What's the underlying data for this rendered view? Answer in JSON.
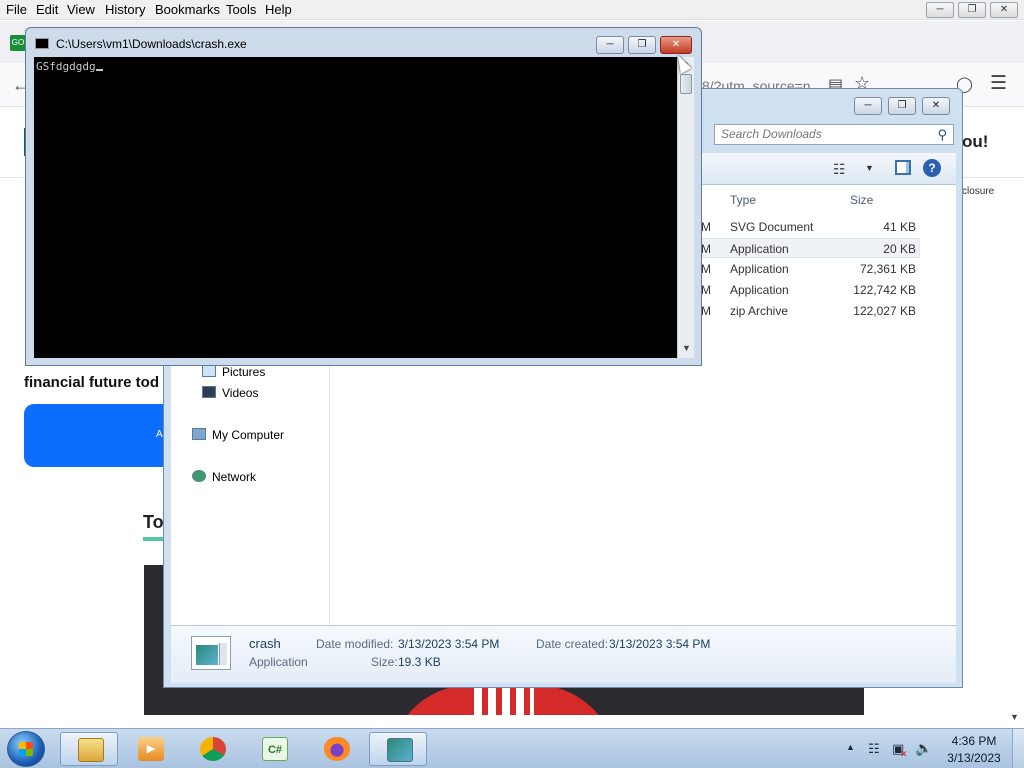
{
  "browser": {
    "menu": [
      "File",
      "Edit",
      "View",
      "History",
      "Bookmarks",
      "Tools",
      "Help"
    ],
    "tab_favicon_text": "GO",
    "url_fragment": "8/?utm_source=n",
    "page": {
      "heading_right": "ou!",
      "disclosure": "closure",
      "financial_text": "financial future tod",
      "cta_text": "A",
      "section_heading": "To"
    }
  },
  "console": {
    "title": "C:\\Users\\vm1\\Downloads\\crash.exe",
    "text": "GSfdgdgdg"
  },
  "explorer": {
    "search_placeholder": "Search Downloads",
    "columns": {
      "type": "Type",
      "size": "Size"
    },
    "files": [
      {
        "date_fragment": "M",
        "type": "SVG Document",
        "size": "41 KB"
      },
      {
        "date_fragment": "M",
        "type": "Application",
        "size": "20 KB",
        "selected": true
      },
      {
        "date_fragment": "M",
        "type": "Application",
        "size": "72,361 KB"
      },
      {
        "date_fragment": "M",
        "type": "Application",
        "size": "122,742 KB"
      },
      {
        "date_fragment": "M",
        "type": "zip Archive",
        "size": "122,027 KB"
      }
    ],
    "nav": {
      "pictures": "Pictures",
      "videos": "Videos",
      "computer": "My Computer",
      "network": "Network"
    },
    "details": {
      "name": "crash",
      "kind": "Application",
      "modified_label": "Date modified:",
      "modified": "3/13/2023 3:54 PM",
      "created_label": "Date created:",
      "created": "3/13/2023 3:54 PM",
      "size_label": "Size:",
      "size": "19.3 KB"
    }
  },
  "taskbar": {
    "time": "4:36 PM",
    "date": "3/13/2023",
    "csharp_label": "C#"
  },
  "colors": {
    "console_bg": "#000000",
    "console_text": "#c8c8c8",
    "close_red": "#c43a24",
    "cta_blue": "#0d6efd",
    "selection": "#eef2f7"
  }
}
